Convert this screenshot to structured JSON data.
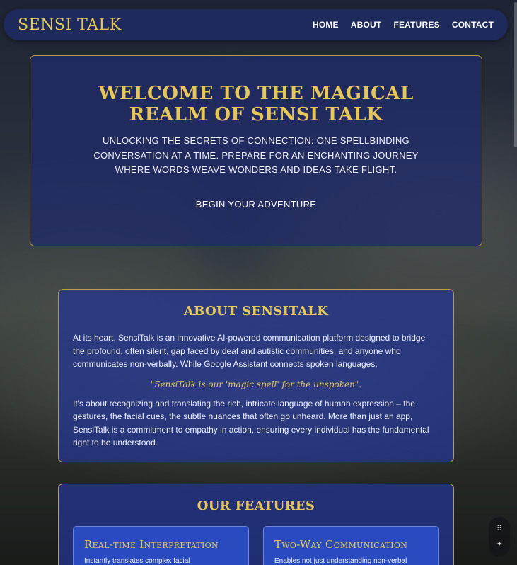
{
  "nav": {
    "brand": "SENSI TALK",
    "links": [
      "HOME",
      "ABOUT",
      "FEATURES",
      "CONTACT"
    ]
  },
  "hero": {
    "title": "WELCOME TO THE MAGICAL REALM OF SENSI TALK",
    "subtitle": "UNLOCKING THE SECRETS OF CONNECTION: ONE SPELLBINDING CONVERSATION AT A TIME. PREPARE FOR AN ENCHANTING JOURNEY WHERE WORDS WEAVE WONDERS AND IDEAS TAKE FLIGHT.",
    "cta": "BEGIN YOUR ADVENTURE"
  },
  "about": {
    "title": "ABOUT SENSITALK",
    "paragraph1": "At its heart, SensiTalk is an innovative AI-powered communication platform designed to bridge the profound, often silent, gap faced by deaf and autistic communities, and anyone who communicates non-verbally. While Google Assistant connects spoken languages,",
    "quote": "\"SensiTalk is our 'magic spell' for the unspoken\".",
    "paragraph2": "It's about recognizing and translating the rich, intricate language of human expression – the gestures, the facial cues, the subtle nuances that often go unheard. More than just an app, SensiTalk is a commitment to empathy in action, ensuring every individual has the fundamental right to be understood."
  },
  "features": {
    "title": "OUR FEATURES",
    "cards": [
      {
        "title": "Real-time Interpretation",
        "desc": "Instantly translates complex facial"
      },
      {
        "title": "Two-Way Communication",
        "desc": "Enables not just understanding non-verbal"
      }
    ]
  },
  "widget": {
    "icons": [
      "drag-handle-icon",
      "sparkle-icon"
    ]
  }
}
